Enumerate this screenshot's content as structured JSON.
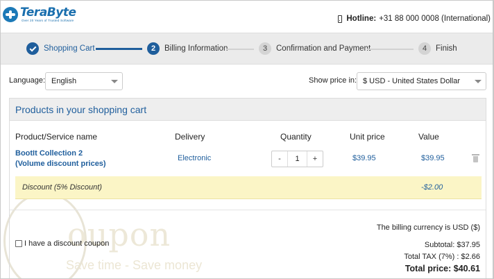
{
  "header": {
    "logo_name": "TeraByte",
    "logo_tagline": "Over 20 Years of Trusted Software",
    "hotline_label": "Hotline:",
    "hotline_number": "+31 88 000 0008 (International)"
  },
  "steps": [
    {
      "num": "1",
      "label": "Shopping Cart",
      "state": "done"
    },
    {
      "num": "2",
      "label": "Billing Information",
      "state": "active"
    },
    {
      "num": "3",
      "label": "Confirmation and Payment",
      "state": "todo"
    },
    {
      "num": "4",
      "label": "Finish",
      "state": "todo"
    }
  ],
  "options": {
    "language_label": "Language:",
    "language_value": "English",
    "price_label": "Show price in:",
    "currency_value": "$ USD - United States Dollar"
  },
  "cart": {
    "title": "Products in your shopping cart",
    "columns": {
      "name": "Product/Service name",
      "delivery": "Delivery",
      "quantity": "Quantity",
      "unit": "Unit price",
      "value": "Value"
    },
    "item": {
      "name_line1": "BootIt Collection 2",
      "name_line2": "(Volume discount prices)",
      "delivery": "Electronic",
      "qty_minus": "-",
      "qty_value": "1",
      "qty_plus": "+",
      "unit_price": "$39.95",
      "value": "$39.95"
    },
    "discount": {
      "label": "Discount (5% Discount)",
      "value": "-$2.00"
    },
    "billing_currency": "The billing currency is USD ($)",
    "coupon_label": "I have a discount coupon",
    "subtotal": "Subtotal: $37.95",
    "tax": "Total TAX (7%) : $2.66",
    "total": "Total price: $40.61"
  },
  "watermark": {
    "word": "oupon",
    "tagline": "Save time - Save money"
  },
  "colors": {
    "accent": "#1f5e9c",
    "discount_bg": "#fbf5c6"
  }
}
